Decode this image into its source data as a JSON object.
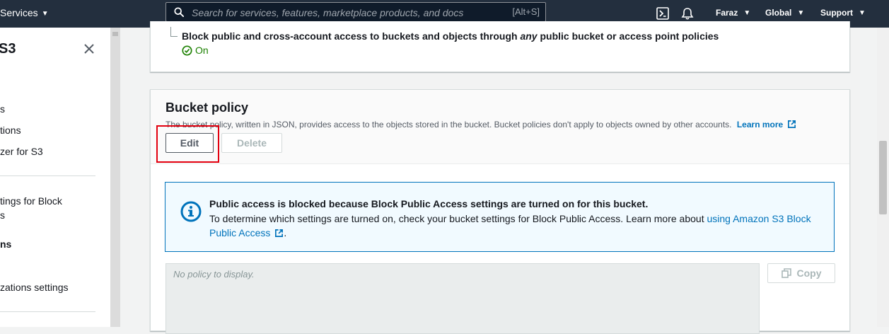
{
  "topnav": {
    "services_label": "Services",
    "search_placeholder": "Search for services, features, marketplace products, and docs",
    "search_shortcut": "[Alt+S]",
    "user_label": "Faraz",
    "region_label": "Global",
    "support_label": "Support",
    "icons": [
      "cloudshell-icon",
      "bell-icon"
    ]
  },
  "sidebar": {
    "title": "S3",
    "items": [
      {
        "label": "s"
      },
      {
        "label": "tions"
      },
      {
        "label": "zer for S3"
      },
      {
        "label": "tings for Block"
      },
      {
        "label": "s"
      },
      {
        "label": "ns"
      },
      {
        "label": "zations settings"
      }
    ]
  },
  "block_public_access": {
    "policies_text_before": "Block public and cross-account access to buckets and objects through ",
    "policies_text_em": "any",
    "policies_text_after": " public bucket or access point policies",
    "status": "On"
  },
  "bucket_policy": {
    "title": "Bucket policy",
    "description": "The bucket policy, written in JSON, provides access to the objects stored in the bucket. Bucket policies don't apply to objects owned by other accounts.",
    "learn_more": "Learn more",
    "edit_label": "Edit",
    "delete_label": "Delete",
    "alert_title": "Public access is blocked because Block Public Access settings are turned on for this bucket.",
    "alert_body": "To determine which settings are turned on, check your bucket settings for Block Public Access. Learn more about ",
    "alert_link": "using Amazon S3 Block Public Access",
    "alert_period": ".",
    "empty_text": "No policy to display.",
    "copy_label": "Copy"
  },
  "colors": {
    "nav_bg": "#232f3e",
    "link": "#0073bb",
    "success": "#1d8102",
    "highlight_border": "#e3000f"
  }
}
